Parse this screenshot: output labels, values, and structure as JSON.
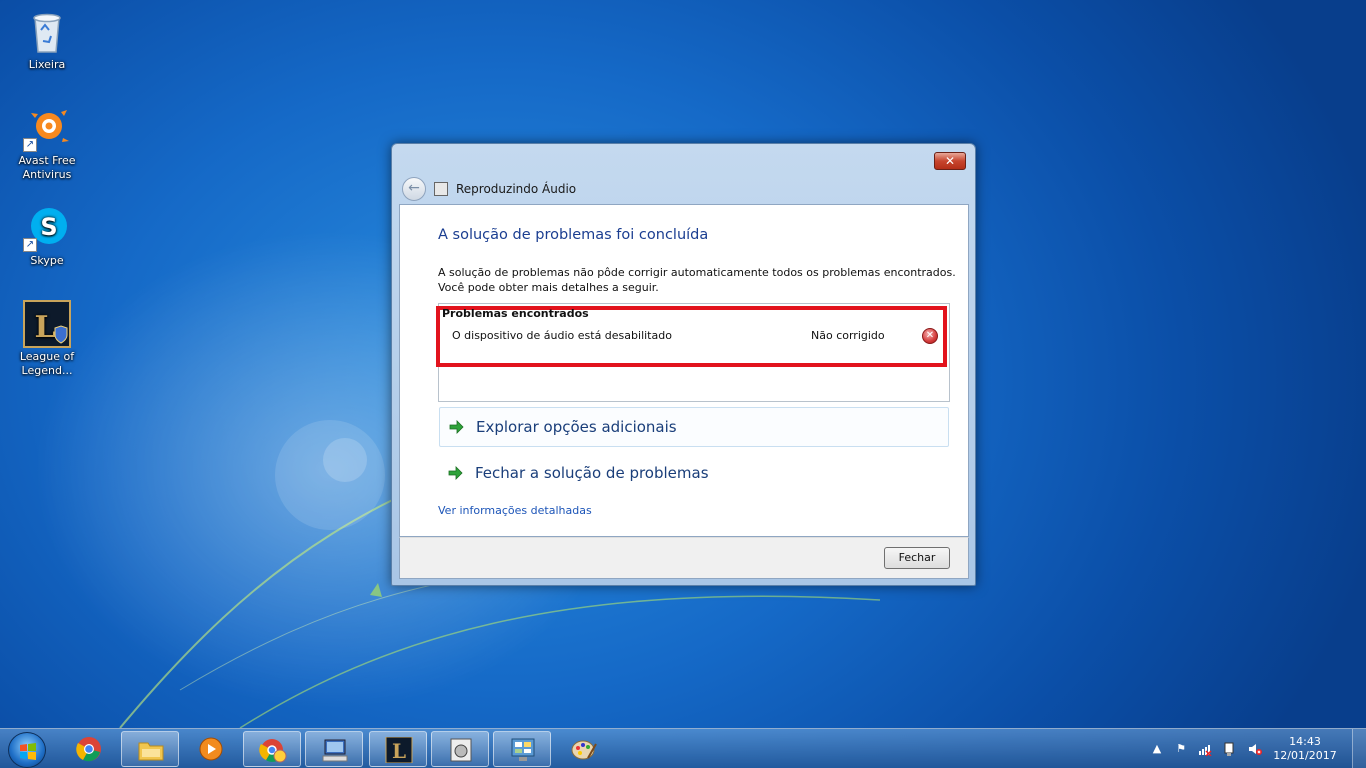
{
  "desktop": {
    "icons": [
      {
        "label": "Lixeira",
        "icon": "recycle-bin-icon"
      },
      {
        "label": "Avast Free Antivirus",
        "icon": "avast-icon"
      },
      {
        "label": "Skype",
        "icon": "skype-icon"
      },
      {
        "label": "League of Legend...",
        "icon": "league-of-legends-icon"
      }
    ]
  },
  "dialog": {
    "close_label": "✕",
    "nav_title": "Reproduzindo Áudio",
    "heading": "A solução de problemas foi concluída",
    "description_line1": "A solução de problemas não pôde corrigir automaticamente todos os problemas encontrados.",
    "description_line2": "Você pode obter mais detalhes a seguir.",
    "problems_header": "Problemas encontrados",
    "problem": {
      "name": "O dispositivo de áudio está desabilitado",
      "status": "Não corrigido",
      "status_icon": "error-icon"
    },
    "links": {
      "explore": "Explorar opções adicionais",
      "close_troubleshooter": "Fechar a solução de problemas",
      "details": "Ver informações detalhadas"
    },
    "close_button": "Fechar"
  },
  "taskbar": {
    "apps": [
      {
        "name": "chrome"
      },
      {
        "name": "windows-explorer"
      },
      {
        "name": "windows-media-player"
      },
      {
        "name": "chrome-profile"
      },
      {
        "name": "remote-desktop"
      },
      {
        "name": "league-of-legends"
      },
      {
        "name": "troubleshooter"
      },
      {
        "name": "control-panel"
      },
      {
        "name": "paint"
      }
    ],
    "clock_time": "14:43",
    "clock_date": "12/01/2017"
  },
  "colors": {
    "heading": "#1b3e91",
    "highlight_border": "#e2131d",
    "link": "#1c55b8"
  }
}
